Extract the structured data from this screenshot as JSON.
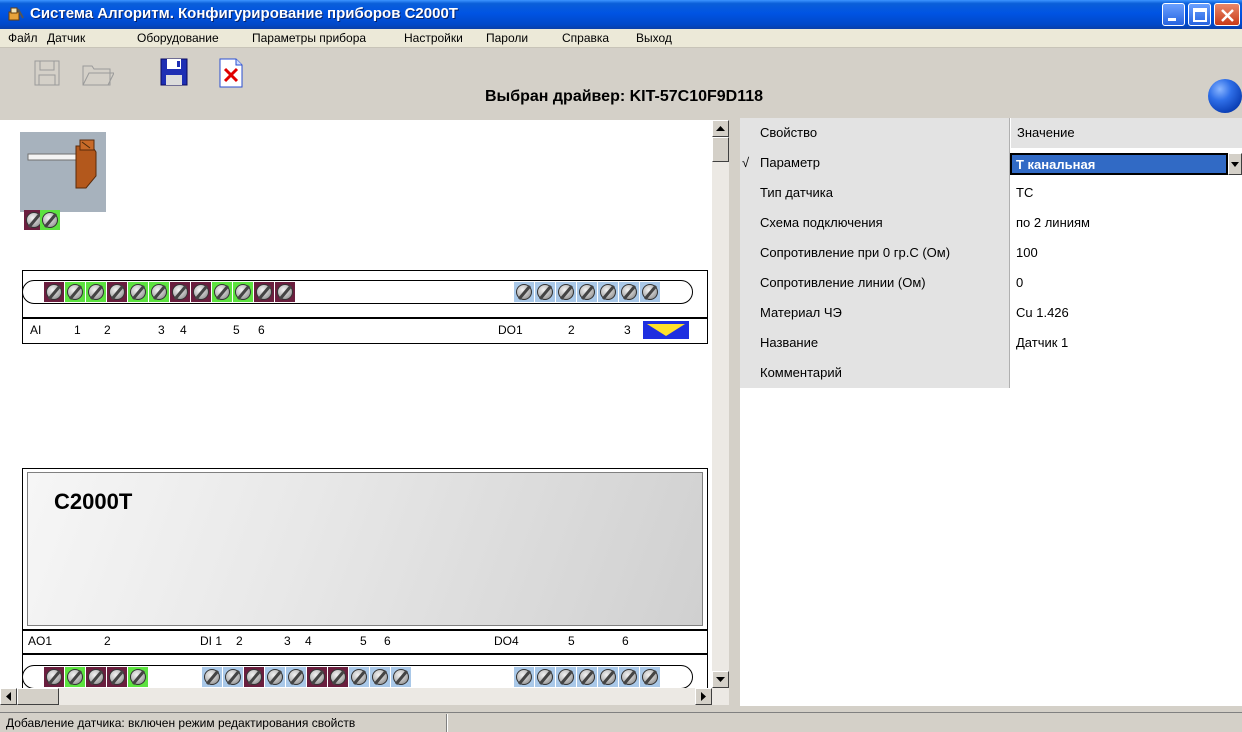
{
  "window": {
    "title": "Система Алгоритм. Конфигурирование приборов С2000Т",
    "colors": {
      "titlebar": "#0054e3",
      "selection": "#316ac5",
      "close": "#c93a17"
    }
  },
  "menu": {
    "items": [
      "Файл",
      "Датчик",
      "Оборудование",
      "Параметры прибора",
      "Настройки",
      "Пароли",
      "Справка",
      "Выход"
    ]
  },
  "toolbar": {
    "icons": [
      "floppy-disabled-icon",
      "folder-disabled-icon",
      "save-icon",
      "delete-file-icon"
    ],
    "driver_label": "Выбран драйвер: KIT-57C10F9D118",
    "status_indicator": "blue-sphere-icon"
  },
  "device": {
    "model": "C2000T",
    "top_labels": [
      "AI",
      "1",
      "2",
      "3",
      "4",
      "5",
      "6",
      "DO1",
      "2",
      "3"
    ],
    "bottom_labels": [
      "AO1",
      "2",
      "DI 1",
      "2",
      "3",
      "4",
      "5",
      "6",
      "DO4",
      "5",
      "6"
    ],
    "sensor_icon": "thermocouple-sensor-icon"
  },
  "properties": {
    "header": {
      "name": "Свойство",
      "value": "Значение"
    },
    "rows": [
      {
        "marker": "√",
        "name": "Параметр",
        "value": "Т канальная",
        "selected": true
      },
      {
        "marker": "",
        "name": "Тип датчика",
        "value": "ТС"
      },
      {
        "marker": "",
        "name": "Схема подключения",
        "value": "по 2 линиям"
      },
      {
        "marker": "",
        "name": "Сопротивление при 0 гр.С (Ом)",
        "value": "100"
      },
      {
        "marker": "",
        "name": "Сопротивление линии (Ом)",
        "value": "0"
      },
      {
        "marker": "",
        "name": "Материал ЧЭ",
        "value": "Cu 1.426"
      },
      {
        "marker": "",
        "name": "Название",
        "value": "Датчик 1"
      },
      {
        "marker": "",
        "name": "Комментарий",
        "value": ""
      }
    ]
  },
  "status": {
    "text": "Добавление датчика: включен режим редактирования свойств"
  }
}
